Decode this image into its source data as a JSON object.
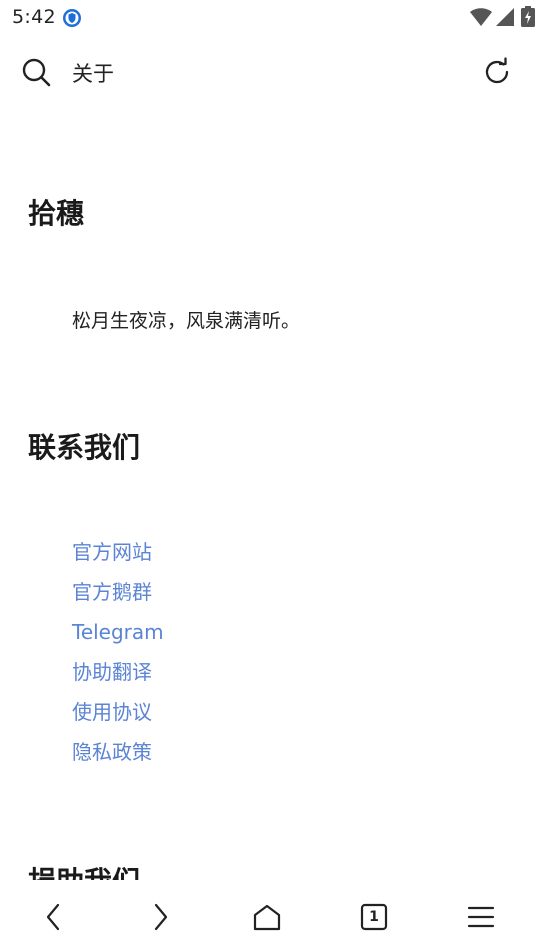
{
  "status_bar": {
    "time": "5:42",
    "app_icon": "shield-app-icon",
    "icons": [
      "wifi-icon",
      "signal-icon",
      "battery-charging-icon"
    ]
  },
  "top_bar": {
    "title": "关于",
    "left_icon": "search-icon",
    "right_icon": "refresh-icon"
  },
  "sections": {
    "about": {
      "heading": "拾穗",
      "text": "松月生夜凉，风泉满清听。"
    },
    "contact": {
      "heading": "联系我们",
      "links": [
        "官方网站",
        "官方鹅群",
        "Telegram",
        "协助翻译",
        "使用协议",
        "隐私政策"
      ]
    },
    "donate": {
      "heading": "捐助我们"
    }
  },
  "bottom_nav": {
    "tab_count": "1",
    "items": [
      "back-icon",
      "forward-icon",
      "home-icon",
      "tabs-icon",
      "menu-icon"
    ]
  },
  "colors": {
    "link": "#5b84d4",
    "text": "#1a1a1a",
    "background": "#ffffff"
  }
}
